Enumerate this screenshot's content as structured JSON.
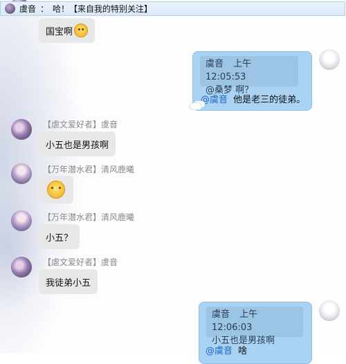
{
  "topbar": {
    "sender": "虞音",
    "colon": "：",
    "message": "哈！【来自我的特别关注】"
  },
  "messages": [
    {
      "text": "国宝啊"
    },
    {
      "quote_sender": "虞音",
      "quote_time": "上午 12:05:53",
      "quote_text": "@桑梦 啊？",
      "mention": "@虞音",
      "reply": "他是老三的徒弟。"
    },
    {
      "sender": "【虐文爱好者】虞音",
      "text": "小五也是男孩啊"
    },
    {
      "sender": "【万年潜水君】清风鹿曦",
      "emoji": "sad-face"
    },
    {
      "sender": "【万年潜水君】清风鹿曦",
      "text": "小五？"
    },
    {
      "sender": "【虐文爱好者】虞音",
      "text": "我徒弟小五"
    },
    {
      "quote_sender": "虞音",
      "quote_time": "上午 12:06:03",
      "quote_text": "小五也是男孩啊",
      "mention": "@虞音",
      "reply": "啥"
    }
  ],
  "colors": {
    "own_bubble": "#a9d2f3",
    "other_bubble": "#e8e8e8",
    "mention": "#1b68c2",
    "topbar": "#dde9f6"
  },
  "icons": {
    "laugh_emoji": "laughing-face-icon",
    "sad_emoji": "worried-face-icon"
  }
}
